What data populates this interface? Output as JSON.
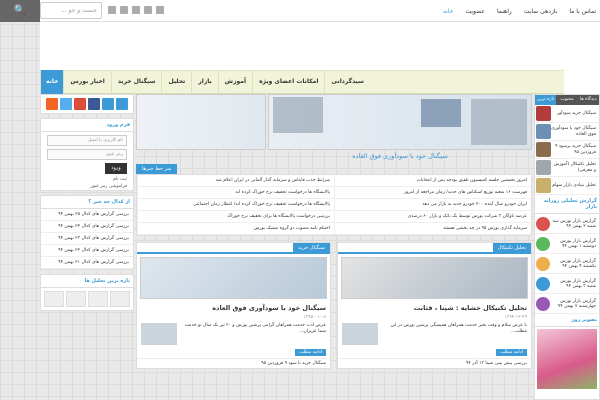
{
  "topbar": {
    "search_placeholder": "جست و جو ...",
    "search_button": "🔍",
    "menu": [
      "خانه",
      "عضویت",
      "راهنما",
      "بازدهی سایت",
      "تماس با ما"
    ]
  },
  "nav": {
    "items": [
      "خانه",
      "اخبار بورس",
      "سیگنال خرید",
      "تحلیل",
      "بازار",
      "آموزش",
      "امکانات اعضای ویژه",
      "سیدگردانی"
    ]
  },
  "right_col": {
    "tabs": [
      "تازه ترین ها",
      "محبوب",
      "دیدگاه ها"
    ],
    "posts": [
      "سیگنال خرید سودآور",
      "سیگنال خود با سودآوری فوق العاده",
      "سیگنال خرید پرسود ۹ فروردین ۹۵",
      "تحلیل تکنیکال (آموزش و معرفی)",
      "تحلیل بنیادی بازار سهام"
    ],
    "report_title": "گزارش تحلیلی روزانه بازار",
    "reports": [
      "گزارش بازار بورس سه شنبه ۲ بهمن ۹۴",
      "گزارش بازار بورس دوشنبه ۱ بهمن ۹۴",
      "گزارش بازار بورس یکشنبه ۴ بهمن ۹۴",
      "گزارش بازار بورس شنبه ۳ بهمن ۹۴",
      "گزارش بازار بورس چهارشنبه ۷ بهمن ۹۴"
    ],
    "photo_title": "تصویر روز"
  },
  "left_col": {
    "login_title": "فرم ورود",
    "username_placeholder": "نام کاربری یا ایمیل",
    "password_placeholder": "رمز عبور",
    "login_button": "ورود",
    "links": [
      "ثبت نام",
      "فراموشی رمز عبور"
    ],
    "list_title": "از کدال چه خبر ؟",
    "list_items": [
      "بررسی گزارش های کدال ۲۵ بهمن ۹۴",
      "بررسی گزارش های کدال ۲۴ بهمن ۹۴",
      "بررسی گزارش های کدال ۲۳ بهمن ۹۴",
      "بررسی گزارش های کدال ۲۲ بهمن ۹۴",
      "بررسی گزارش های کدال ۲۱ بهمن ۹۴"
    ],
    "logos_title": "تازه ترین تحلیل ها"
  },
  "center": {
    "banner_title": "سیگنال خود با سودآوری فوق العاده",
    "news_head": "سر خط خبرها",
    "news": [
      "امروز نخستین جلسه کمیسیون تلفیق بودجه پس از انتخابات",
      "شرایط جذب فایناس و سرمایه گذار آلمانی در ایران اعلام شد",
      "فهرست ۱۶ شعبه توزیع اسکناس های جدید/ زمان مراجعه از امروز",
      "پالایشگاه ها درخواست تخفیف نرخ خوراک کرده اند",
      "ایران خودرو سال آینده ۲۰۰ خودرو جدید به بازار می دهد",
      "پالایشگاه ها درخواست تخفیف نرخ خوراک کرده اند/ انتظار زمان اجتماعی",
      "عرضه ناوگان ۳ شرکت بورس توسط یک بانک و بازار ۶۰ درصدی",
      "بررسی درخواست پالایشگاه ها برای تخفیف نرخ خوراک",
      "سرمایه گذاری بورس ۹۵ در چه بخشی هستند",
      "اختتام نامه مصوب دو گروه مشبک بورس"
    ],
    "cat_right": {
      "head": "سیگنال خرید",
      "title": "سیگنال خود با سودآوری فوق العاده",
      "meta": "۱۳۹۵-۰۱-۰۷",
      "sub": "عرض ادب خدمت همراهان گرامی پرشین بورس و ۲۰ تیر بک سال نو خدمت شما عزیزان...",
      "more": "ادامه مطلب",
      "last": "سیگنال خرید با سود ۹ فروردین ۹۵"
    },
    "cat_left": {
      "head": "تحلیل تکنیکال",
      "title": "تحلیل تکنیکال خشایه : شپنا ، قثابت",
      "meta": "۱۳۹۴-۱۲-۲۹",
      "sub": "با عرض سلام و وقت بخیر خدمت همراهان همیشگی پرشین بورس در این مطلب...",
      "more": "ادامه مطلب",
      "last": "بررسی پیش بینی شپنا ۱۳ آذر ۹۴"
    }
  },
  "colors": {
    "accent": "#3c9bd6",
    "nav_bg": "#f2f4d9"
  }
}
